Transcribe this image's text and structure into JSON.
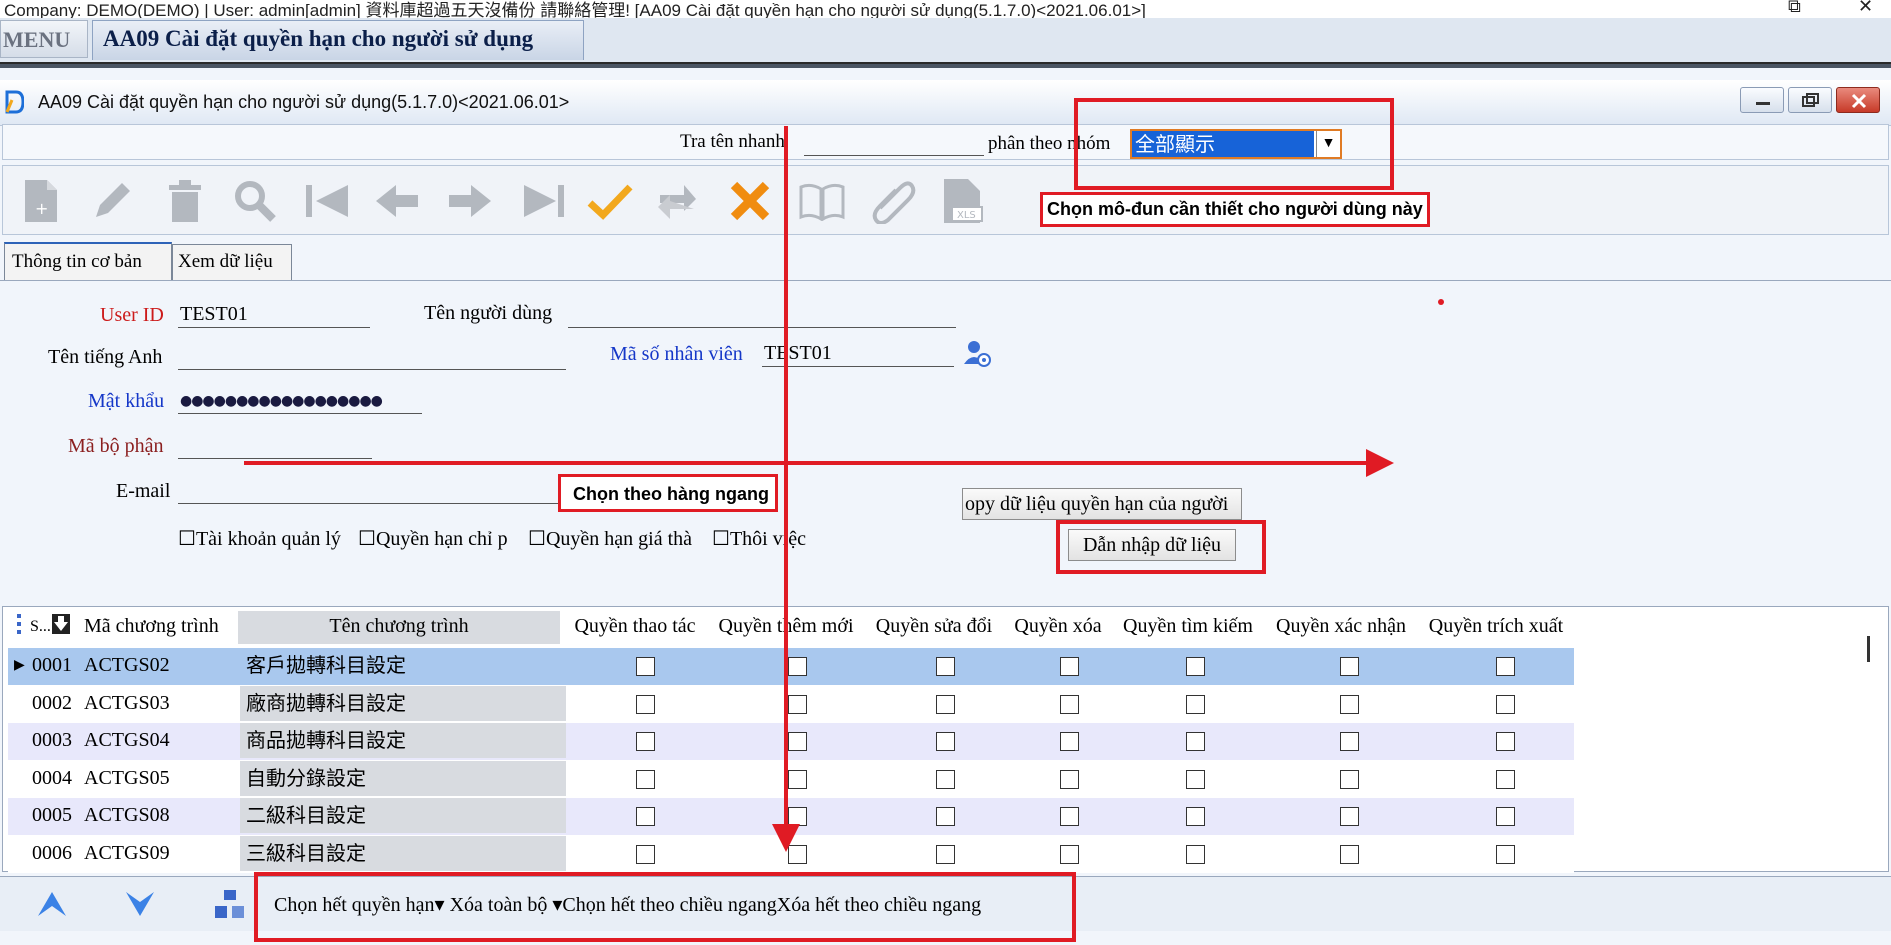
{
  "outer_title": "Company: DEMO(DEMO) | User: admin[admin] 資料庫超過五天沒備份 請聯絡管理! [AA09 Cài đặt quyền hạn cho người sử dụng(5.1.7.0)<2021.06.01>]",
  "menu": {
    "menu_label": "MENU",
    "page_tab": "AA09 Cài đặt quyền hạn cho người sử dụng"
  },
  "window": {
    "title": "AA09 Cài đặt quyền hạn cho người sử dụng(5.1.7.0)<2021.06.01>"
  },
  "search": {
    "quick_label": "Tra tên nhanh",
    "quick_value": "",
    "group_label": "phân theo nhóm",
    "group_value": "全部顯示"
  },
  "toolbar": {
    "icons": [
      "new-icon",
      "edit-icon",
      "delete-icon",
      "search-icon",
      "first-icon",
      "prev-icon",
      "next-icon",
      "last-icon",
      "confirm-icon",
      "undo-icon",
      "cancel-icon",
      "book-icon",
      "attach-icon",
      "xls-icon"
    ]
  },
  "tabs": {
    "basic": "Thông tin cơ bản",
    "view": "Xem dữ liệu"
  },
  "form": {
    "user_id_label": "User ID",
    "user_id_value": "TEST01",
    "user_name_label": "Tên người dùng",
    "user_name_value": "",
    "english_name_label": "Tên tiếng Anh",
    "english_name_value": "",
    "employee_no_label": "Mã số nhân viên",
    "employee_no_value": "TEST01",
    "password_label": "Mật khẩu",
    "password_value": "●●●●●●●●●●●●●●●●●●",
    "department_label": "Mã bộ phận",
    "department_value": "",
    "email_label": "E-mail",
    "email_value": "",
    "checkboxes": [
      "Tài khoản quản lý",
      "Quyền hạn chỉ p",
      "Quyền hạn giá thà",
      "Thôi việc"
    ],
    "copy_button": "opy dữ liệu quyền hạn của người",
    "import_button": "Dẫn nhập dữ liệu"
  },
  "grid": {
    "headers": [
      "S...",
      "Mã chương trình",
      "Tên chương trình",
      "Quyền thao tác",
      "Quyền thêm mới",
      "Quyền sửa đổi",
      "Quyền xóa",
      "Quyền tìm kiếm",
      "Quyền xác nhận",
      "Quyền trích xuất"
    ],
    "rows": [
      {
        "no": "0001",
        "code": "ACTGS02",
        "name": "客戶拋轉科目設定"
      },
      {
        "no": "0002",
        "code": "ACTGS03",
        "name": "廠商拋轉科目設定"
      },
      {
        "no": "0003",
        "code": "ACTGS04",
        "name": "商品拋轉科目設定"
      },
      {
        "no": "0004",
        "code": "ACTGS05",
        "name": "自動分錄設定"
      },
      {
        "no": "0005",
        "code": "ACTGS08",
        "name": "二級科目設定"
      },
      {
        "no": "0006",
        "code": "ACTGS09",
        "name": "三級科目設定"
      }
    ]
  },
  "bottom": {
    "links": "Chọn hết quyền hạn▾ Xóa toàn bộ ▾Chọn hết theo chiều ngangXóa hết theo chiều ngang"
  },
  "annotations": {
    "module_callout": "Chọn mô-đun cần thiết cho người dùng này",
    "horizontal_callout": "Chọn theo hàng ngang",
    "color": "#e01b24"
  },
  "colors": {
    "selected_row": "#a9c8ee",
    "row_alt": "#e8e8fb",
    "select_highlight": "#1763d8"
  }
}
